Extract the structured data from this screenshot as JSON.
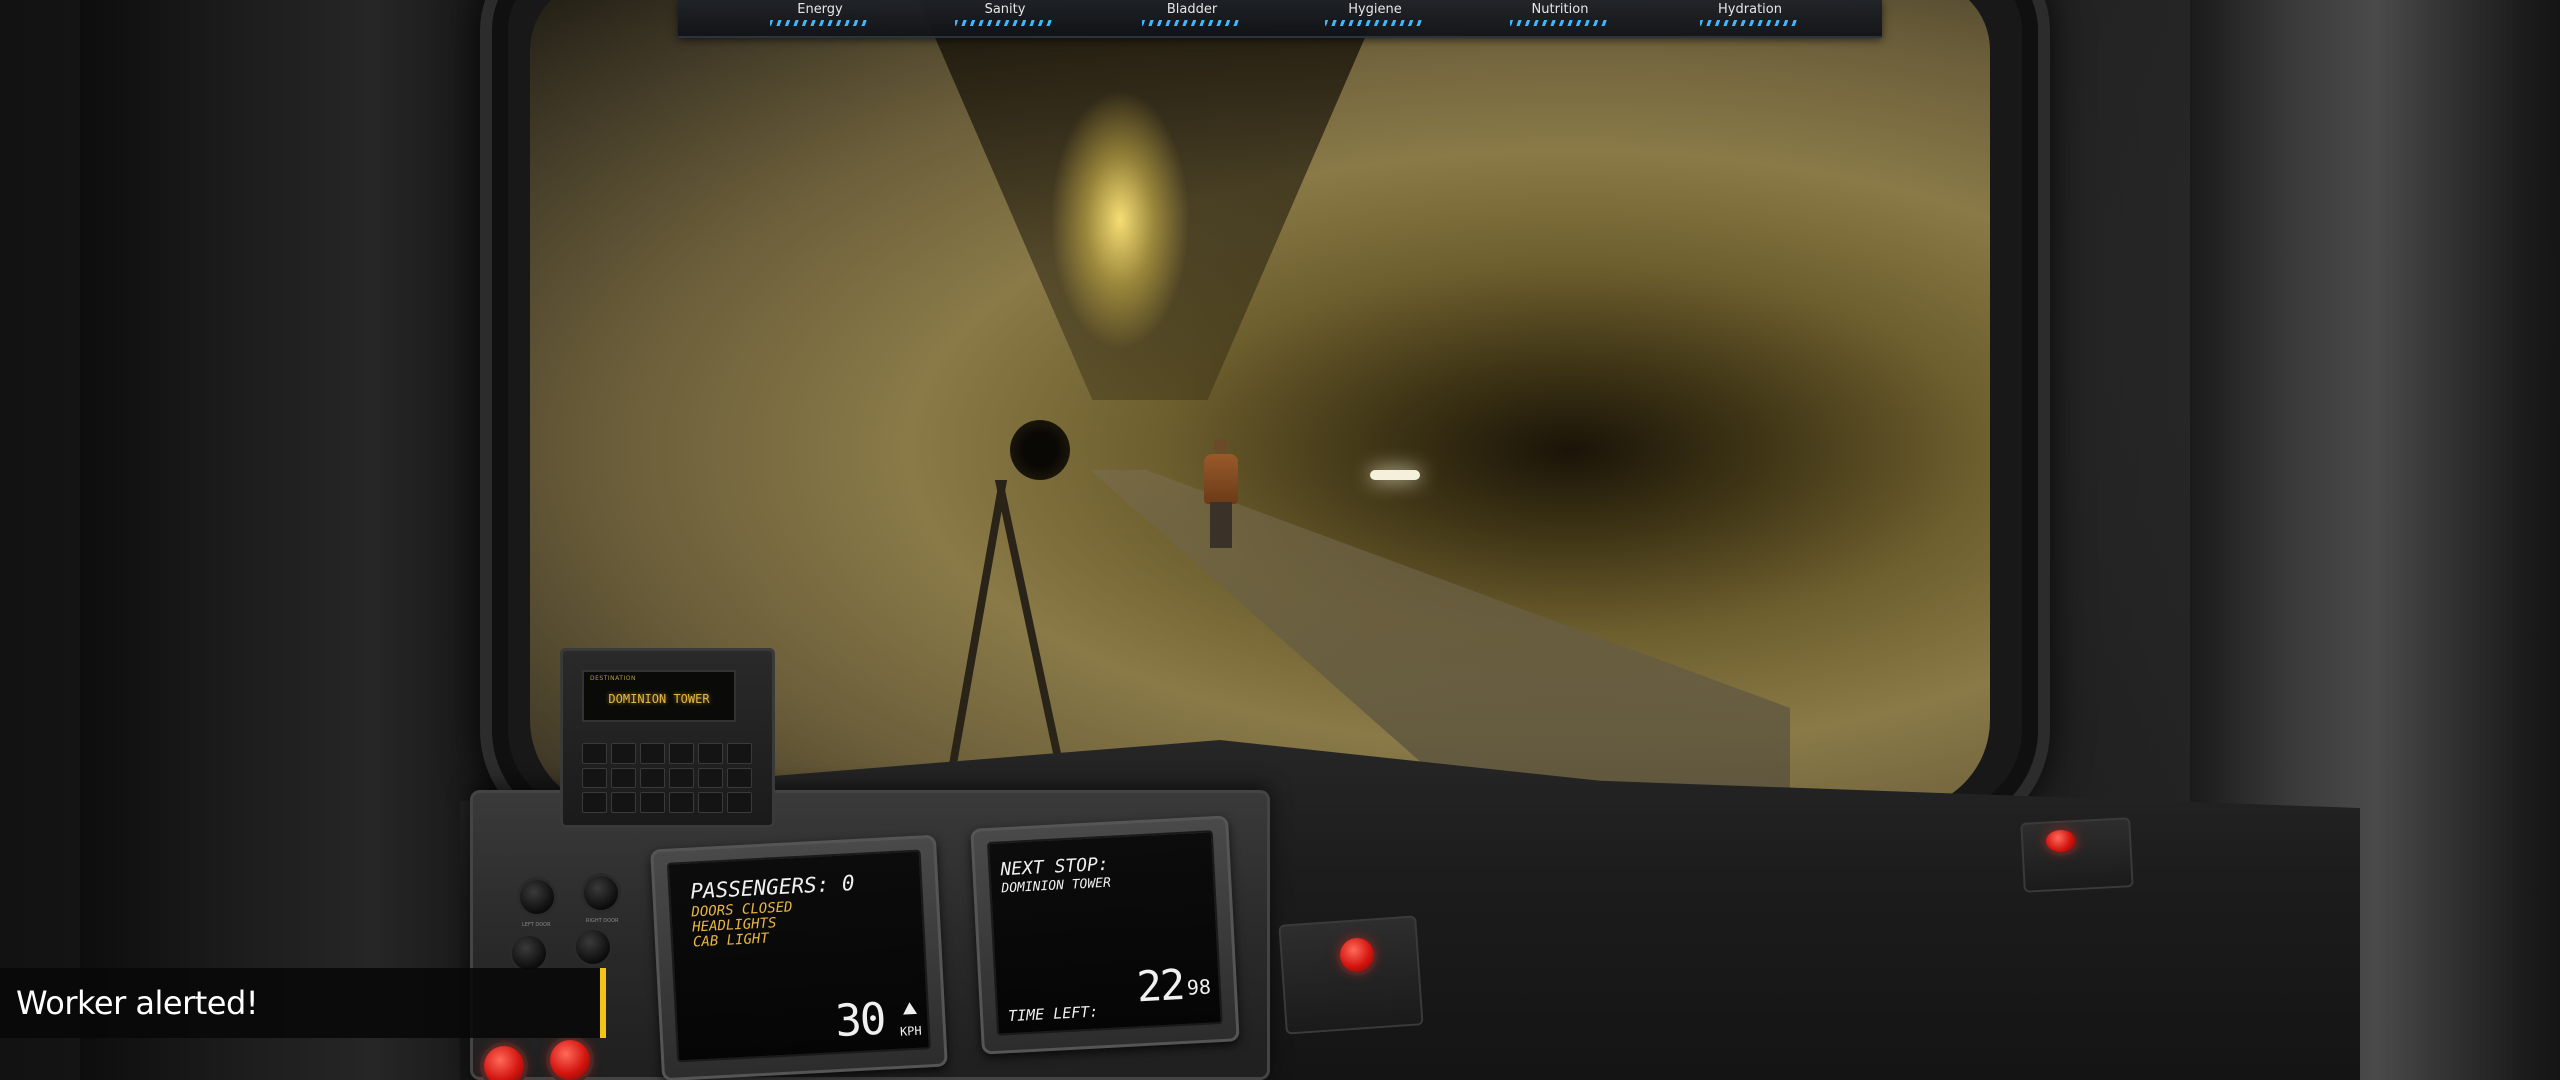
{
  "hud": {
    "stats": [
      {
        "label": "Energy",
        "level": 1.0
      },
      {
        "label": "Sanity",
        "level": 1.0
      },
      {
        "label": "Bladder",
        "level": 1.0
      },
      {
        "label": "Hygiene",
        "level": 1.0
      },
      {
        "label": "Nutrition",
        "level": 1.0
      },
      {
        "label": "Hydration",
        "level": 1.0
      }
    ],
    "meter_color": "#3fb6ff"
  },
  "destination_display": {
    "caption": "DESTINATION",
    "value": "DOMINION TOWER"
  },
  "status_monitor": {
    "passengers": "PASSENGERS: 0",
    "lines": [
      "DOORS CLOSED",
      "HEADLIGHTS",
      "CAB LIGHT"
    ],
    "speed": "30",
    "speed_unit": "KPH",
    "trend_icon": "triangle-up-icon"
  },
  "next_stop_monitor": {
    "heading": "NEXT STOP:",
    "station": "DOMINION TOWER",
    "time_label": "TIME LEFT:",
    "time_main": "22",
    "time_fraction": "98"
  },
  "controls": {
    "knob_labels": [
      "LEFT DOOR",
      "RIGHT DOOR"
    ]
  },
  "alert": {
    "message": "Worker alerted!",
    "accent_color": "#f2c417"
  },
  "colors": {
    "display_amber": "#e8b640",
    "monitor_text": "#f0f0f0",
    "warning_red": "#d3150f"
  }
}
